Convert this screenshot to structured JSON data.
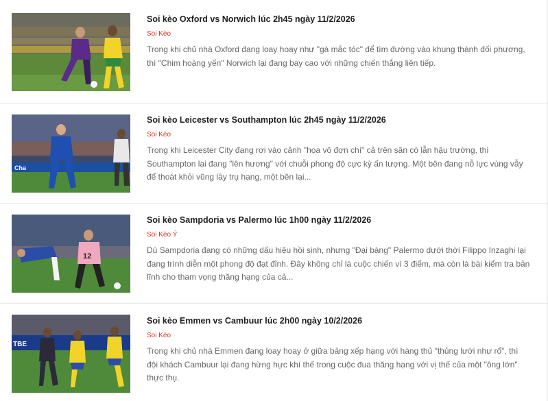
{
  "articles": [
    {
      "title": "Soi kèo Oxford vs Norwich lúc 2h45 ngày 11/2/2026",
      "category": "Soi Kèo",
      "excerpt": "Trong khi chủ nhà Oxford đang loay hoay như \"gà mắc tóc\" để tìm đường vào khung thành đối phương, thì \"Chim hoàng yến\" Norwich lại đang bay cao với những chiến thắng liên tiếp."
    },
    {
      "title": "Soi kèo Leicester vs Southampton lúc 2h45 ngày 11/2/2026",
      "category": "Soi Kèo",
      "excerpt": "Trong khi Leicester City đang rơi vào cảnh \"họa vô đơn chí\" cả trên sân cỏ lẫn hậu trường, thì Southampton lại đang \"lên hương\" với chuỗi phong độ cực kỳ ấn tượng. Một bên đang nỗ lực vùng vẫy để thoát khỏi vũng lầy trụ hạng, một bên lại..."
    },
    {
      "title": "Soi kèo Sampdoria vs Palermo lúc 1h00 ngày 11/2/2026",
      "category": "Soi Kèo Ý",
      "excerpt": "Dù Sampdoria đang có những dấu hiệu hồi sinh, nhưng \"Đại bàng\" Palermo dưới thời Filippo Inzaghi lại đang trình diễn một phong độ đạt đỉnh. Đây không chỉ là cuộc chiến vì 3 điểm, mà còn là bài kiểm tra bản lĩnh cho tham vọng thăng hạng của cả..."
    },
    {
      "title": "Soi kèo Emmen vs Cambuur lúc 2h00 ngày 10/2/2026",
      "category": "Soi Kèo",
      "excerpt": "Trong khi chủ nhà Emmen đang loay hoay ở giữa bảng xếp hạng với hàng thủ \"thủng lưới như rổ\", thì đội khách Cambuur lại đang hừng hực khí thế trong cuộc đua thăng hạng với vị thế của một \"ông lớn\" thực thụ."
    }
  ],
  "colors": {
    "title": "#1f1f1f",
    "category": "#d9331f",
    "excerpt": "#666666",
    "divider": "#e6e6e6"
  },
  "thumbnails": [
    {
      "scene": "Oxford (purple) vs Norwich (yellow) match photo",
      "icon": "football-photo"
    },
    {
      "scene": "Leicester (blue) vs Southampton match photo",
      "icon": "football-photo"
    },
    {
      "scene": "Sampdoria vs Palermo (pink) match photo",
      "icon": "football-photo"
    },
    {
      "scene": "Emmen vs Cambuur (yellow) match photo",
      "icon": "football-photo"
    }
  ]
}
